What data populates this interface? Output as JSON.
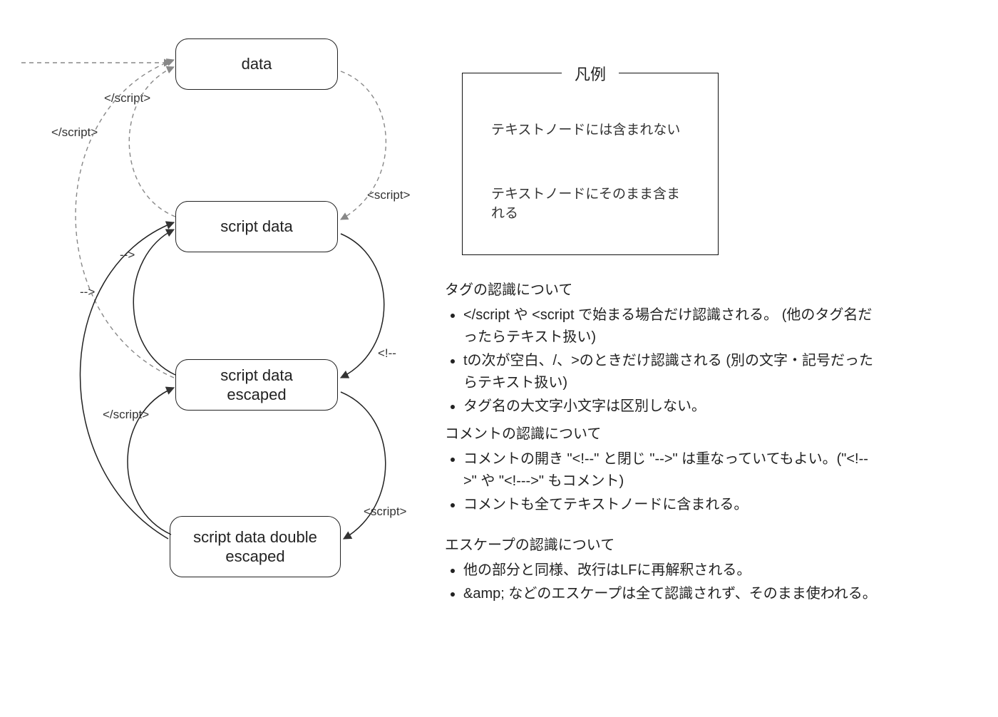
{
  "nodes": {
    "data": "data",
    "script_data": "script data",
    "escaped": "script data escaped",
    "double_escaped": "script data double escaped"
  },
  "edges": {
    "close_script_1": "</script>",
    "close_script_2": "</script>",
    "close_script_3": "</script>",
    "open_script_1": "<script>",
    "open_script_2": "<script>",
    "comment_open": "<!--",
    "comment_close_1": "-->",
    "comment_close_2": "-->"
  },
  "legend": {
    "title": "凡例",
    "not_included": "テキストノードには含まれない",
    "included": "テキストノードにそのまま含まれる"
  },
  "sections": {
    "tag": {
      "heading": "タグの認識について",
      "items": [
        "</script や <script で始まる場合だけ認識される。 (他のタグ名だったらテキスト扱い)",
        "tの次が空白、/、>のときだけ認識される (別の文字・記号だったらテキスト扱い)",
        "タグ名の大文字小文字は区別しない。"
      ]
    },
    "comment": {
      "heading": "コメントの認識について",
      "items": [
        "コメントの開き \"<!--\" と閉じ \"-->\" は重なっていてもよい。(\"<!-->\" や \"<!--->\" もコメント)",
        "コメントも全てテキストノードに含まれる。"
      ]
    },
    "escape": {
      "heading": "エスケープの認識について",
      "items": [
        "他の部分と同様、改行はLFに再解釈される。",
        "&amp; などのエスケープは全て認識されず、そのまま使われる。"
      ]
    }
  }
}
